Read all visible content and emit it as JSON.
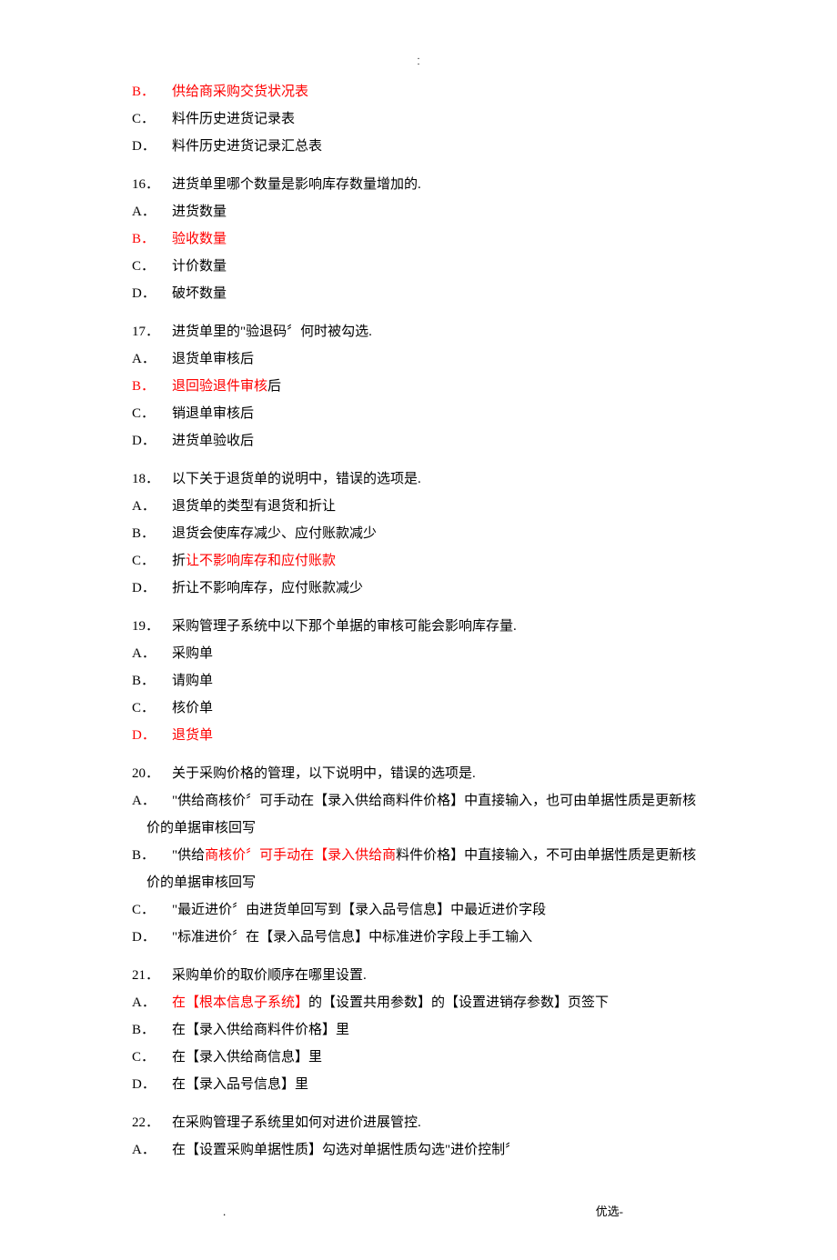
{
  "header": {
    "dot1": ".",
    "dot2": "."
  },
  "orphan": {
    "b_marker": "B．",
    "b_text": "供给商采购交货状况表",
    "c_marker": "C．",
    "c_text": "料件历史进货记录表",
    "d_marker": "D．",
    "d_text": "料件历史进货记录汇总表"
  },
  "q16": {
    "num": "16．",
    "text": "进货单里哪个数量是影响库存数量增加的.",
    "a_marker": "A．",
    "a_text": "进货数量",
    "b_marker": "B．",
    "b_text": "验收数量",
    "c_marker": "C．",
    "c_text": "计价数量",
    "d_marker": "D．",
    "d_text": "破坏数量"
  },
  "q17": {
    "num": "17．",
    "text": "进货单里的\"验退码〞何时被勾选.",
    "a_marker": "A．",
    "a_text": "退货单审核后",
    "b_marker": "B．",
    "b_red": "退回验退件审核",
    "b_black": "后",
    "c_marker": "C．",
    "c_text": "销退单审核后",
    "d_marker": "D．",
    "d_text": "进货单验收后"
  },
  "q18": {
    "num": "18．",
    "text": "以下关于退货单的说明中，错误的选项是.",
    "a_marker": "A．",
    "a_text": "退货单的类型有退货和折让",
    "b_marker": "B．",
    "b_text": "退货会使库存减少、应付账款减少",
    "c_marker": "C．",
    "c_black_pre": "折",
    "c_red": "让不影响库存和应付账款",
    "d_marker": "D．",
    "d_text": "折让不影响库存，应付账款减少"
  },
  "q19": {
    "num": "19．",
    "text": "采购管理子系统中以下那个单据的审核可能会影响库存量.",
    "a_marker": "A．",
    "a_text": "采购单",
    "b_marker": "B．",
    "b_text": "请购单",
    "c_marker": "C．",
    "c_text": "核价单",
    "d_marker": "D．",
    "d_text": "退货单"
  },
  "q20": {
    "num": "20．",
    "text": "关于采购价格的管理，以下说明中，错误的选项是.",
    "a_marker": "A．",
    "a_text": "\"供给商核价〞可手动在【录入供给商料件价格】中直接输入，也可由单据性质是更新核价的单据审核回写",
    "b_marker": "B．",
    "b_black_pre": "\"供给",
    "b_red": "商核价〞可手动在【录入供给商",
    "b_black_post": "料件价格】中直接输入，不可由单据性质是更新核价的单据审核回写",
    "c_marker": "C．",
    "c_text": "\"最近进价〞由进货单回写到【录入品号信息】中最近进价字段",
    "d_marker": "D．",
    "d_text": "\"标准进价〞在【录入品号信息】中标准进价字段上手工输入"
  },
  "q21": {
    "num": "21．",
    "text": "采购单价的取价顺序在哪里设置.",
    "a_marker": "A．",
    "a_red": "在【根本信息子系统】",
    "a_black": "的【设置共用参数】的【设置进销存参数】页签下",
    "b_marker": "B．",
    "b_text": "在【录入供给商料件价格】里",
    "c_marker": "C．",
    "c_text": "在【录入供给商信息】里",
    "d_marker": "D．",
    "d_text": "在【录入品号信息】里"
  },
  "q22": {
    "num": "22．",
    "text": "在采购管理子系统里如何对进价进展管控.",
    "a_marker": "A．",
    "a_text": "在【设置采购单据性质】勾选对单据性质勾选\"进价控制〞"
  },
  "footer": {
    "left": ".",
    "right": "优选-"
  }
}
